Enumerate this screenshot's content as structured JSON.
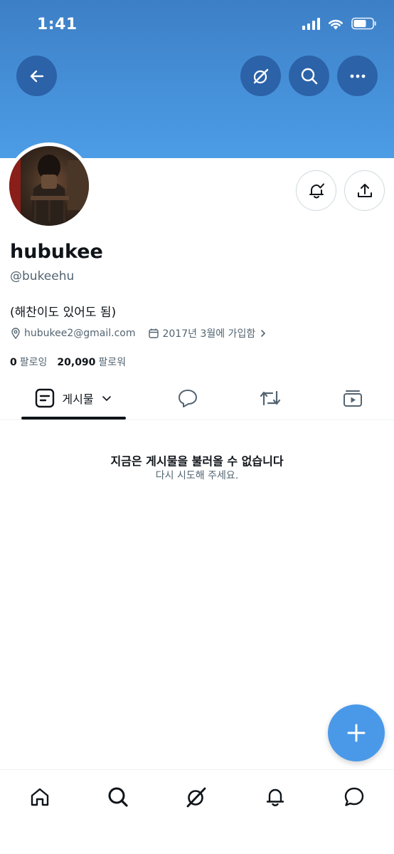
{
  "status_bar": {
    "time": "1:41"
  },
  "header": {
    "back_icon": "arrow-left-icon",
    "grok_icon": "grok-icon",
    "search_icon": "search-icon",
    "more_icon": "more-horizontal-icon"
  },
  "profile": {
    "display_name": "hubukee",
    "handle": "@bukeehu",
    "bio": "(해찬이도 있어도 됨)",
    "email": "hubukee2@gmail.com",
    "joined": "2017년 3월에 가입함",
    "following_count": "0",
    "following_label": "팔로잉",
    "followers_count": "20,090",
    "followers_label": "팔로워"
  },
  "tabs": {
    "posts_label": "게시물"
  },
  "empty_state": {
    "title": "지금은 게시물을 불러올 수 없습니다",
    "subtitle": "다시 시도해 주세요."
  },
  "bottom_nav": [
    "home-icon",
    "search-icon",
    "grok-icon",
    "notifications-icon",
    "messages-icon"
  ],
  "colors": {
    "banner": "#4590d8",
    "header_button": "#2c62a8",
    "fab": "#4a99e9",
    "text_primary": "#0f1419",
    "text_secondary": "#536471"
  }
}
